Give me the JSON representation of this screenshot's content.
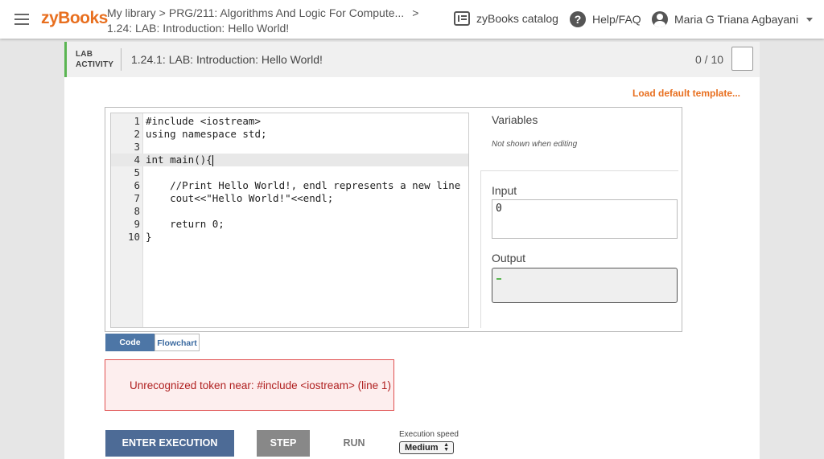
{
  "header": {
    "logo": "zyBooks",
    "breadcrumb": {
      "library": "My library",
      "sep": ">",
      "book": "PRG/211: Algorithms And Logic For Compute...",
      "chevron": ">",
      "section": "1.24: LAB: Introduction: Hello World!"
    },
    "catalog_label": "zyBooks catalog",
    "help_label": "Help/FAQ",
    "user_name": "Maria G Triana Agbayani"
  },
  "activity": {
    "tag_line1": "LAB",
    "tag_line2": "ACTIVITY",
    "title": "1.24.1: LAB: Introduction: Hello World!",
    "score": "0 / 10",
    "load_default": "Load default template..."
  },
  "editor": {
    "lines": [
      {
        "n": "1",
        "text": "#include <iostream>"
      },
      {
        "n": "2",
        "text": "using namespace std;"
      },
      {
        "n": "3",
        "text": ""
      },
      {
        "n": "4",
        "text": "int main(){"
      },
      {
        "n": "5",
        "text": ""
      },
      {
        "n": "6",
        "text": "    //Print Hello World!, endl represents a new line"
      },
      {
        "n": "7",
        "text": "    cout<<\"Hello World!\"<<endl;"
      },
      {
        "n": "8",
        "text": ""
      },
      {
        "n": "9",
        "text": "    return 0;"
      },
      {
        "n": "10",
        "text": "}"
      }
    ]
  },
  "panel": {
    "variables_label": "Variables",
    "not_shown": "Not shown when editing",
    "input_label": "Input",
    "input_value": "0",
    "output_label": "Output"
  },
  "tabs": {
    "code": "Code",
    "flowchart": "Flowchart"
  },
  "error": {
    "message": "Unrecognized token near: #include <iostream> (line 1)"
  },
  "controls": {
    "enter_execution": "ENTER EXECUTION",
    "step": "STEP",
    "run": "RUN",
    "speed_label": "Execution speed",
    "speed_value": "Medium"
  },
  "colors": {
    "brand": "#e86f1f",
    "activity_accent": "#5ab552",
    "primary_button": "#4d6b96",
    "error": "#b02020"
  }
}
